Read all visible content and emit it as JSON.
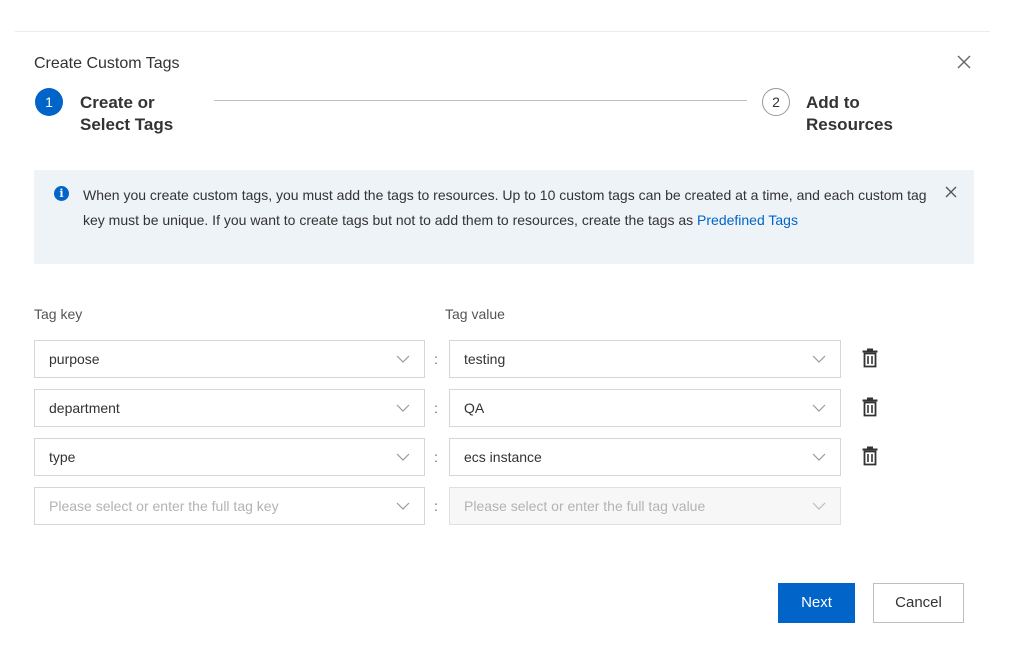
{
  "dialog": {
    "title": "Create Custom Tags"
  },
  "steps": [
    {
      "number": "1",
      "label": "Create or Select Tags",
      "state": "active"
    },
    {
      "number": "2",
      "label": "Add to Resources",
      "state": "pending"
    }
  ],
  "notice": {
    "text": "When you create custom tags, you must add the tags to resources. Up to 10 custom tags can be created at a time, and each custom tag key must be unique. If you want to create tags but not to add them to resources, create the tags as ",
    "link": "Predefined Tags",
    "icon": "info-icon"
  },
  "columns": {
    "key": "Tag key",
    "value": "Tag value"
  },
  "separator": ":",
  "rows": [
    {
      "key": "purpose",
      "value": "testing"
    },
    {
      "key": "department",
      "value": "QA"
    },
    {
      "key": "type",
      "value": "ecs instance"
    }
  ],
  "empty_row": {
    "key_placeholder": "Please select or enter the full tag key",
    "value_placeholder": "Please select or enter the full tag value"
  },
  "buttons": {
    "next": "Next",
    "cancel": "Cancel"
  },
  "colors": {
    "primary": "#0064c8",
    "notice_bg": "#eef3f8"
  }
}
